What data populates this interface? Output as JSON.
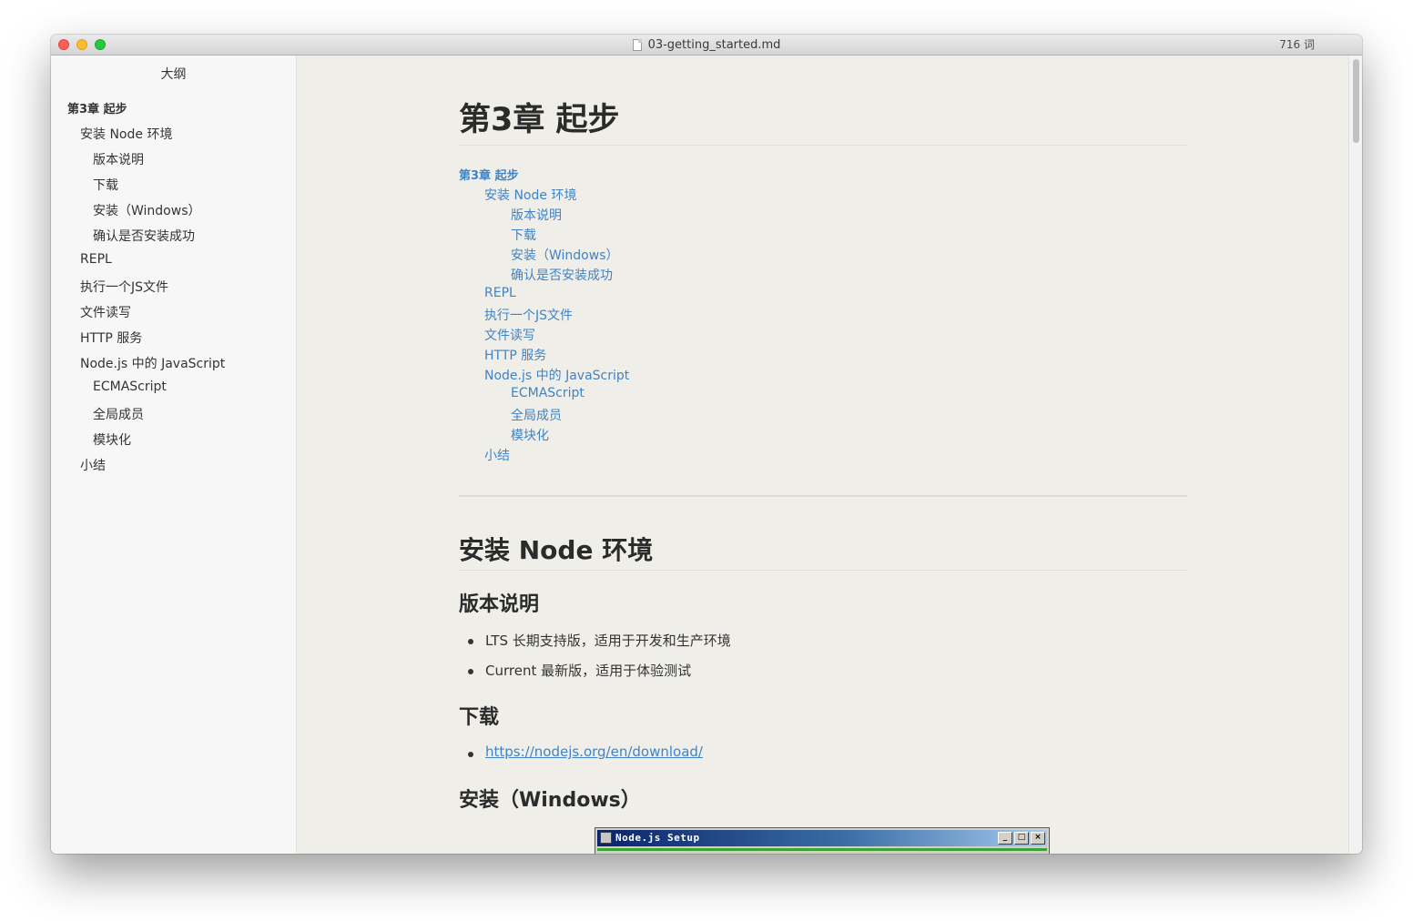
{
  "window": {
    "file_name": "03-getting_started.md",
    "word_count": "716 词"
  },
  "sidebar": {
    "header": "大纲",
    "items": [
      {
        "label": "第3章 起步",
        "level": 1
      },
      {
        "label": "安装 Node 环境",
        "level": 2
      },
      {
        "label": "版本说明",
        "level": 3
      },
      {
        "label": "下载",
        "level": 3
      },
      {
        "label": "安装（Windows）",
        "level": 3
      },
      {
        "label": "确认是否安装成功",
        "level": 3
      },
      {
        "label": "REPL",
        "level": 2
      },
      {
        "label": "执行一个JS文件",
        "level": 2
      },
      {
        "label": "文件读写",
        "level": 2
      },
      {
        "label": "HTTP 服务",
        "level": 2
      },
      {
        "label": "Node.js 中的 JavaScript",
        "level": 2
      },
      {
        "label": "ECMAScript",
        "level": 3
      },
      {
        "label": "全局成员",
        "level": 3
      },
      {
        "label": "模块化",
        "level": 3
      },
      {
        "label": "小结",
        "level": 2
      }
    ]
  },
  "main": {
    "h1": "第3章 起步",
    "toc": [
      {
        "label": "第3章 起步",
        "level": 1
      },
      {
        "label": "安装 Node 环境",
        "level": 2
      },
      {
        "label": "版本说明",
        "level": 3
      },
      {
        "label": "下载",
        "level": 3
      },
      {
        "label": "安装（Windows）",
        "level": 3
      },
      {
        "label": "确认是否安装成功",
        "level": 3
      },
      {
        "label": "REPL",
        "level": 2
      },
      {
        "label": "执行一个JS文件",
        "level": 2
      },
      {
        "label": "文件读写",
        "level": 2
      },
      {
        "label": "HTTP 服务",
        "level": 2
      },
      {
        "label": "Node.js 中的 JavaScript",
        "level": 2
      },
      {
        "label": "ECMAScript",
        "level": 3
      },
      {
        "label": "全局成员",
        "level": 3
      },
      {
        "label": "模块化",
        "level": 3
      },
      {
        "label": "小结",
        "level": 2
      }
    ],
    "section_install_node": "安装 Node 环境",
    "section_version": "版本说明",
    "version_items": [
      "LTS 长期支持版，适用于开发和生产环境",
      "Current 最新版，适用于体验测试"
    ],
    "section_download": "下载",
    "download_link": "https://nodejs.org/en/download/",
    "section_install_windows": "安装（Windows）",
    "embedded_window_title": "Node.js Setup"
  },
  "colors": {
    "link": "#4183c4",
    "text": "#333333",
    "content_bg": "#efeee9",
    "sidebar_bg": "#f7f7f7"
  }
}
